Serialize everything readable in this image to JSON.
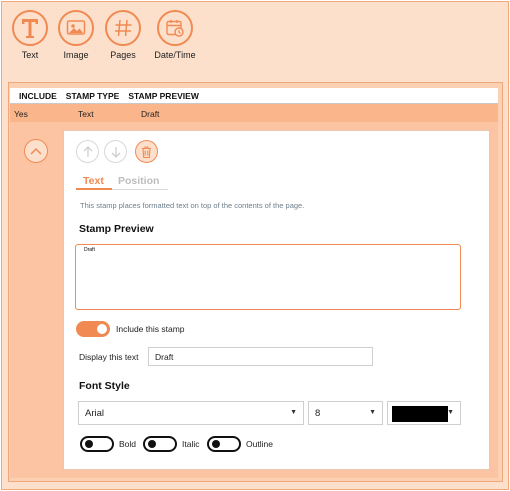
{
  "toolbar": {
    "items": [
      {
        "label": "Text",
        "icon": "text-T-icon"
      },
      {
        "label": "Image",
        "icon": "image-icon"
      },
      {
        "label": "Pages",
        "icon": "hash-icon"
      },
      {
        "label": "Date/Time",
        "icon": "calendar-clock-icon"
      }
    ]
  },
  "table": {
    "headers": [
      "INCLUDE",
      "STAMP TYPE",
      "STAMP PREVIEW"
    ],
    "rows": [
      {
        "include": "Yes",
        "type": "Text",
        "preview": "Draft"
      }
    ]
  },
  "detail": {
    "tabs": [
      "Text",
      "Position"
    ],
    "active_tab": "Text",
    "description": "This stamp places formatted text on top of the contents of the page.",
    "preview_heading": "Stamp Preview",
    "preview_text": "Draft",
    "include_label": "Include this stamp",
    "include_on": true,
    "display_label": "Display this text",
    "display_value": "Draft",
    "font_heading": "Font Style",
    "font_family": "Arial",
    "font_size": "8",
    "font_color": "#000000",
    "styles": [
      {
        "label": "Bold",
        "on": false
      },
      {
        "label": "Italic",
        "on": false
      },
      {
        "label": "Outline",
        "on": false
      }
    ]
  },
  "colors": {
    "accent": "#f08a52",
    "panel": "#fde0cc"
  }
}
